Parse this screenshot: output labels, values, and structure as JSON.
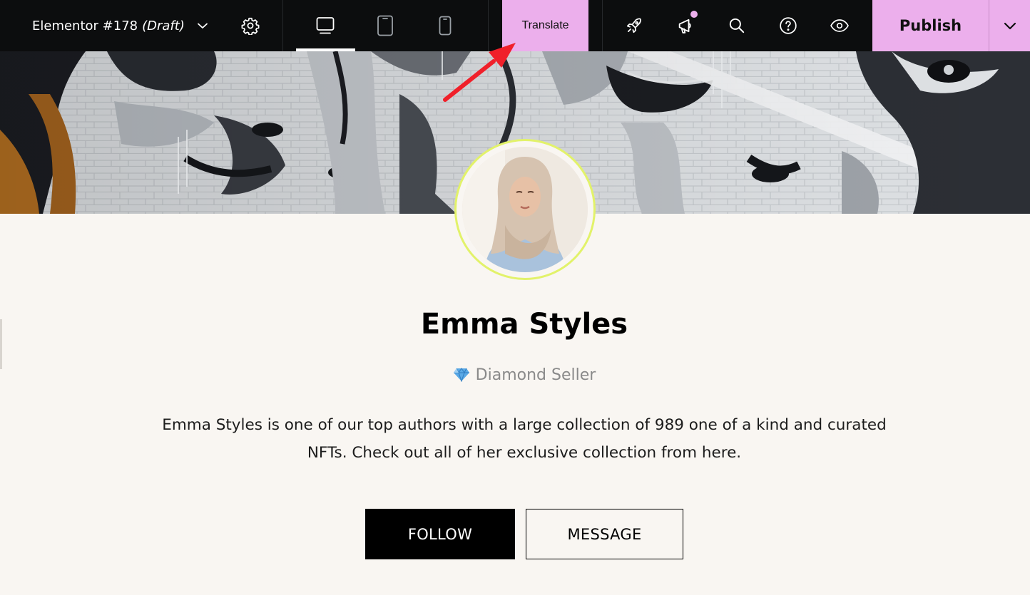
{
  "topbar": {
    "doc_title": "Elementor #178",
    "doc_status": "(Draft)",
    "translate_label": "Translate",
    "publish_label": "Publish",
    "active_device": "desktop"
  },
  "profile": {
    "name": "Emma Styles",
    "badge_label": "Diamond Seller",
    "bio": "Emma Styles is one of our top authors with a large collection of 989 one of a kind and curated NFTs. Check out all of her exclusive collection from here.",
    "follow_label": "FOLLOW",
    "message_label": "MESSAGE"
  },
  "icons": {
    "settings": "gear-icon",
    "desktop": "desktop-icon",
    "tablet": "tablet-icon",
    "mobile": "mobile-icon",
    "launch": "rocket-icon",
    "announcements": "megaphone-icon",
    "search": "search-icon",
    "help": "help-icon",
    "preview": "eye-icon",
    "badge": "diamond-icon"
  },
  "colors": {
    "topbar_bg": "#0c0d0e",
    "accent_pink": "#ecafec",
    "avatar_ring": "#e2f26a",
    "page_bg": "#f9f6f2",
    "annotation_arrow": "#f0202a"
  }
}
